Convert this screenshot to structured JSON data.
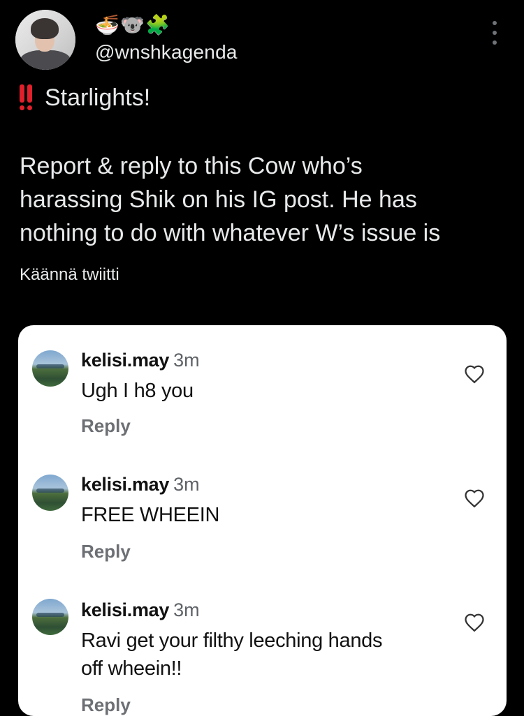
{
  "author": {
    "avatar_icon": "profile-photo",
    "emoji_icons": [
      "noodle-bowl-icon",
      "koala-icon",
      "puzzle-piece-icon"
    ],
    "emoji_glyphs": [
      "🍜",
      "🐨",
      "🧩"
    ],
    "handle": "@wnshkagenda"
  },
  "tweet": {
    "heading_icon": "double-exclamation-icon",
    "heading": "Starlights!",
    "lines": [
      "Report & reply to this Cow who’s",
      "harassing Shik on his IG post. He has",
      "nothing to do with whatever W’s issue is"
    ],
    "translate_label": "Käännä twiitti"
  },
  "embedded_screenshot": {
    "comments": [
      {
        "username": "kelisi.may",
        "time": "3m",
        "lines": [
          "Ugh I h8 you"
        ],
        "reply_label": "Reply"
      },
      {
        "username": "kelisi.may",
        "time": "3m",
        "lines": [
          "FREE WHEEIN"
        ],
        "reply_label": "Reply"
      },
      {
        "username": "kelisi.may",
        "time": "3m",
        "lines": [
          "Ravi get your filthy leeching hands",
          "off wheein!!"
        ],
        "reply_label": "Reply"
      }
    ]
  },
  "colors": {
    "background": "#000000",
    "text": "#e7e9ea",
    "accent_red": "#e0202b",
    "card_bg": "#ffffff",
    "muted": "#6c6f73"
  }
}
